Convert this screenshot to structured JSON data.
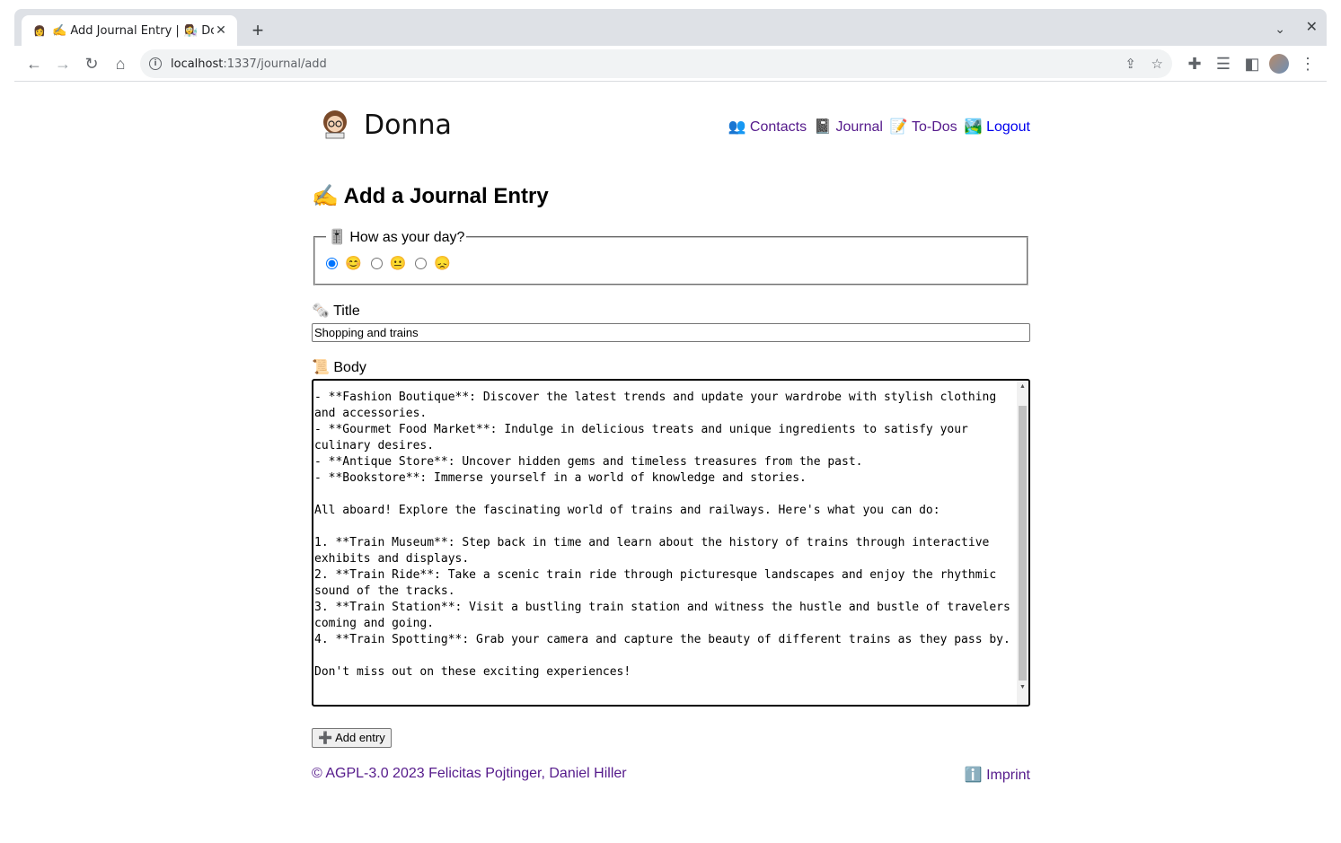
{
  "browser": {
    "tab_title": "✍️ Add Journal Entry | 👩‍🔬 Donna",
    "url_host": "localhost",
    "url_path": ":1337/journal/add"
  },
  "site": {
    "brand": "Donna",
    "nav": [
      {
        "icon": "👥",
        "label": "Contacts"
      },
      {
        "icon": "📓",
        "label": "Journal"
      },
      {
        "icon": "📝",
        "label": "To-Dos"
      },
      {
        "icon": "🏞️",
        "label": "Logout"
      }
    ]
  },
  "form": {
    "heading": "✍️ Add a Journal Entry",
    "mood_legend": "🎚️ How as your day?",
    "moods": [
      {
        "emoji": "😊",
        "checked": true
      },
      {
        "emoji": "😐",
        "checked": false
      },
      {
        "emoji": "😞",
        "checked": false
      }
    ],
    "title_label": "🗞️ Title",
    "title_value": "Shopping and trains",
    "body_label": "📜 Body",
    "body_value": "\n- **Fashion Boutique**: Discover the latest trends and update your wardrobe with stylish clothing and accessories.\n- **Gourmet Food Market**: Indulge in delicious treats and unique ingredients to satisfy your culinary desires.\n- **Antique Store**: Uncover hidden gems and timeless treasures from the past.\n- **Bookstore**: Immerse yourself in a world of knowledge and stories.\n\nAll aboard! Explore the fascinating world of trains and railways. Here's what you can do:\n\n1. **Train Museum**: Step back in time and learn about the history of trains through interactive exhibits and displays.\n2. **Train Ride**: Take a scenic train ride through picturesque landscapes and enjoy the rhythmic sound of the tracks.\n3. **Train Station**: Visit a bustling train station and witness the hustle and bustle of travelers coming and going.\n4. **Train Spotting**: Grab your camera and capture the beauty of different trains as they pass by.\n\nDon't miss out on these exciting experiences!",
    "submit_label": "➕ Add entry"
  },
  "footer": {
    "copyright": "© AGPL-3.0 2023 Felicitas Pojtinger, Daniel Hiller",
    "imprint": "ℹ️ Imprint"
  }
}
